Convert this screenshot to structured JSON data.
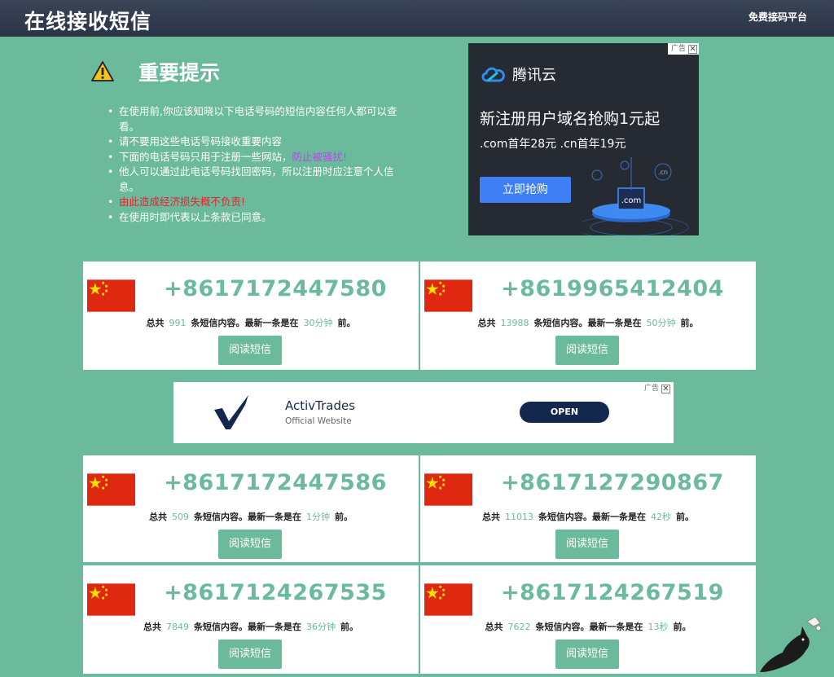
{
  "header": {
    "site_title": "在线接收短信",
    "nav_link": "免费接码平台"
  },
  "notice": {
    "title": "重要提示",
    "icon": "warning-icon",
    "items": [
      "在使用前,你应该知晓以下电话号码的短信内容任何人都可以查看。",
      "请不要用这些电话号码接收重要内容",
      "下面的电话号码只用于注册一些网站，",
      "防止被骚扰!",
      "他人可以通过此电话号码找回密码，所以注册时应注意个人信息。",
      "由此造成经济损失概不负责!",
      "在使用时即代表以上条款已同意。"
    ]
  },
  "ads": {
    "badge": "广告",
    "close": "✕",
    "tencent": {
      "logo_text": "腾讯云",
      "headline": "新注册用户域名抢购1元起",
      "subline": ".com首年28元 .cn首年19元",
      "button": "立即抢购",
      "art_labels": [
        ".com",
        ".cn"
      ]
    },
    "activtrades": {
      "name": "ActivTrades",
      "subtitle": "Official Website",
      "button": "OPEN"
    }
  },
  "labels": {
    "total_prefix": "总共",
    "count_suffix": "条短信内容。最新一条是在",
    "time_suffix": "前。",
    "read_button": "阅读短信"
  },
  "numbers": [
    {
      "phone": "+8617172447580",
      "count": "991",
      "latest": "30分钟"
    },
    {
      "phone": "+8619965412404",
      "count": "13988",
      "latest": "50分钟"
    },
    {
      "phone": "+8617172447586",
      "count": "509",
      "latest": "1分钟"
    },
    {
      "phone": "+8617127290867",
      "count": "11013",
      "latest": "42秒"
    },
    {
      "phone": "+8617124267535",
      "count": "7849",
      "latest": "36分钟"
    },
    {
      "phone": "+8617124267519",
      "count": "7622",
      "latest": "13秒"
    }
  ],
  "colors": {
    "background": "#6bba9c",
    "header": "#2f3a4d",
    "accent": "#6bba9c",
    "flag_red": "#de2910",
    "flag_star": "#ffde00"
  }
}
